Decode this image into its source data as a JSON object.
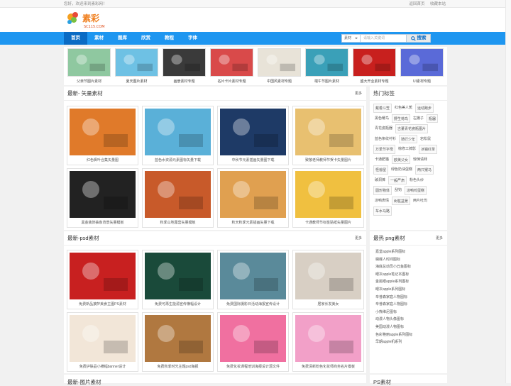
{
  "topbar": {
    "greeting": "您好，欢迎来到素彩网！",
    "links": [
      "返回首页",
      "收藏本站"
    ]
  },
  "logo": {
    "text": "素彩",
    "sub": "SC115.COM"
  },
  "nav": {
    "items": [
      "首页",
      "素材",
      "图库",
      "欣赏",
      "教程",
      "字体"
    ],
    "active": 0
  },
  "search": {
    "select": "素材",
    "placeholder": "请输入关键词",
    "button": "搜索"
  },
  "strip": {
    "items": [
      {
        "label": "父亲节图片素材",
        "color": "#8fc8a0"
      },
      {
        "label": "夏天图片素材",
        "color": "#6ec1e4"
      },
      {
        "label": "画册素材专题",
        "color": "#3a3a3a"
      },
      {
        "label": "名片卡片素材专题",
        "color": "#d94a4a"
      },
      {
        "label": "中国风素材专题",
        "color": "#e8e3d8"
      },
      {
        "label": "端午节图片素材",
        "color": "#3aa0b8"
      },
      {
        "label": "盛大开业素材专题",
        "color": "#c8201e"
      },
      {
        "label": "UI素材专题",
        "color": "#5a6ad8"
      }
    ]
  },
  "vector": {
    "title": "最新- 矢量素材",
    "more": "更多",
    "items": [
      {
        "label": "红色枫叶合集矢量图",
        "color": "#e07a2a"
      },
      {
        "label": "蓝色水资源元素图标矢量下载",
        "color": "#5ab0d8"
      },
      {
        "label": "中秋节元素插画矢量图下载",
        "color": "#1e3a66"
      },
      {
        "label": "致敬老师教师节贺卡矢量图片",
        "color": "#e8c070"
      },
      {
        "label": "黑金装饰抽象背景矢量模板",
        "color": "#222222"
      },
      {
        "label": "秋季山地露营矢量模板",
        "color": "#c85a2a"
      },
      {
        "label": "秋天秋季元素插画矢量下载",
        "color": "#e0a050"
      },
      {
        "label": "卡通教师节标签贴纸矢量图片",
        "color": "#f0c040"
      }
    ]
  },
  "psd": {
    "title": "最新-psd素材",
    "more": "更多",
    "items": [
      {
        "label": "免费新品披萨美食主图PS素材",
        "color": "#c82020"
      },
      {
        "label": "免费可再生能源宣传横幅设计",
        "color": "#1a4a3a"
      },
      {
        "label": "免费国际摄影日活动海报宣传设计",
        "color": "#5a8a9a"
      },
      {
        "label": "居家长发美女",
        "color": "#d8cfc4"
      },
      {
        "label": "免费护肤品小横幅banner设计",
        "color": "#f2e6d8"
      },
      {
        "label": "免费秋季时光主题psd海报",
        "color": "#b07840"
      },
      {
        "label": "免费化妆课程培训海报设计源文件",
        "color": "#f070a0"
      },
      {
        "label": "免费清新粉色化妆师商务名片模板",
        "color": "#f2a0c8"
      }
    ]
  },
  "next_section": {
    "title": "最新-图片素材"
  },
  "hot_tags": {
    "title": "热门标签",
    "tags": [
      {
        "text": "戴着斗笠",
        "box": true
      },
      {
        "text": "红色美人蕉",
        "box": false
      },
      {
        "text": "运动跑步",
        "box": true
      },
      {
        "text": "黑色耀鸟",
        "box": false
      },
      {
        "text": "野生荷鸟",
        "box": true
      },
      {
        "text": "左撇子",
        "box": false
      },
      {
        "text": "瓶器",
        "box": true
      },
      {
        "text": "青花瓷瓶器",
        "box": false
      },
      {
        "text": "古董青花瓷瓶图片",
        "box": true
      },
      {
        "text": "蓝色条纹衬衫",
        "box": false
      },
      {
        "text": "骑行少年",
        "box": true
      },
      {
        "text": "岩松鼠",
        "box": false
      },
      {
        "text": "万圣节字母",
        "box": true
      },
      {
        "text": "棕修工牌影",
        "box": false
      },
      {
        "text": "冰镇红茶",
        "box": true
      },
      {
        "text": "卡通肥猫",
        "box": false
      },
      {
        "text": "欧美父女",
        "box": true
      },
      {
        "text": "惊悚请拜",
        "box": false
      },
      {
        "text": "怪兽屋",
        "box": true
      },
      {
        "text": "绿色奶油蛋糕",
        "box": false
      },
      {
        "text": "两只猴马",
        "box": true
      },
      {
        "text": "破洞裤",
        "box": false
      },
      {
        "text": "一般严肃",
        "box": true
      },
      {
        "text": "粉色头纱",
        "box": false
      },
      {
        "text": "圆形物体",
        "box": true
      },
      {
        "text": "刮钧",
        "box": false
      },
      {
        "text": "凉鸭鸡蛋糕",
        "box": true
      },
      {
        "text": "凉鸭表情",
        "box": false
      },
      {
        "text": "树桩盆景",
        "box": true
      },
      {
        "text": "两片吐司",
        "box": false
      },
      {
        "text": "车水马路",
        "box": true
      }
    ]
  },
  "hot_png": {
    "title": "最热 png素材",
    "more": "更多",
    "items": [
      "嘉堂apple系列图标",
      "蝴蝶人时间图标",
      "海底总动员小丑鱼图标",
      "眼灰apple笔记本图标",
      "金属眼apple系列图标",
      "眼灰apple系列图标",
      "辛普森家庭人物图标",
      "辛普森家庭人物图标",
      "小熊维尼图标",
      "动漫人物头像图标",
      "美国动漫人物图标",
      "色彩艳丽apple系列图标",
      "早期apple机系列"
    ]
  },
  "ps_section": {
    "title": "PS素材"
  }
}
